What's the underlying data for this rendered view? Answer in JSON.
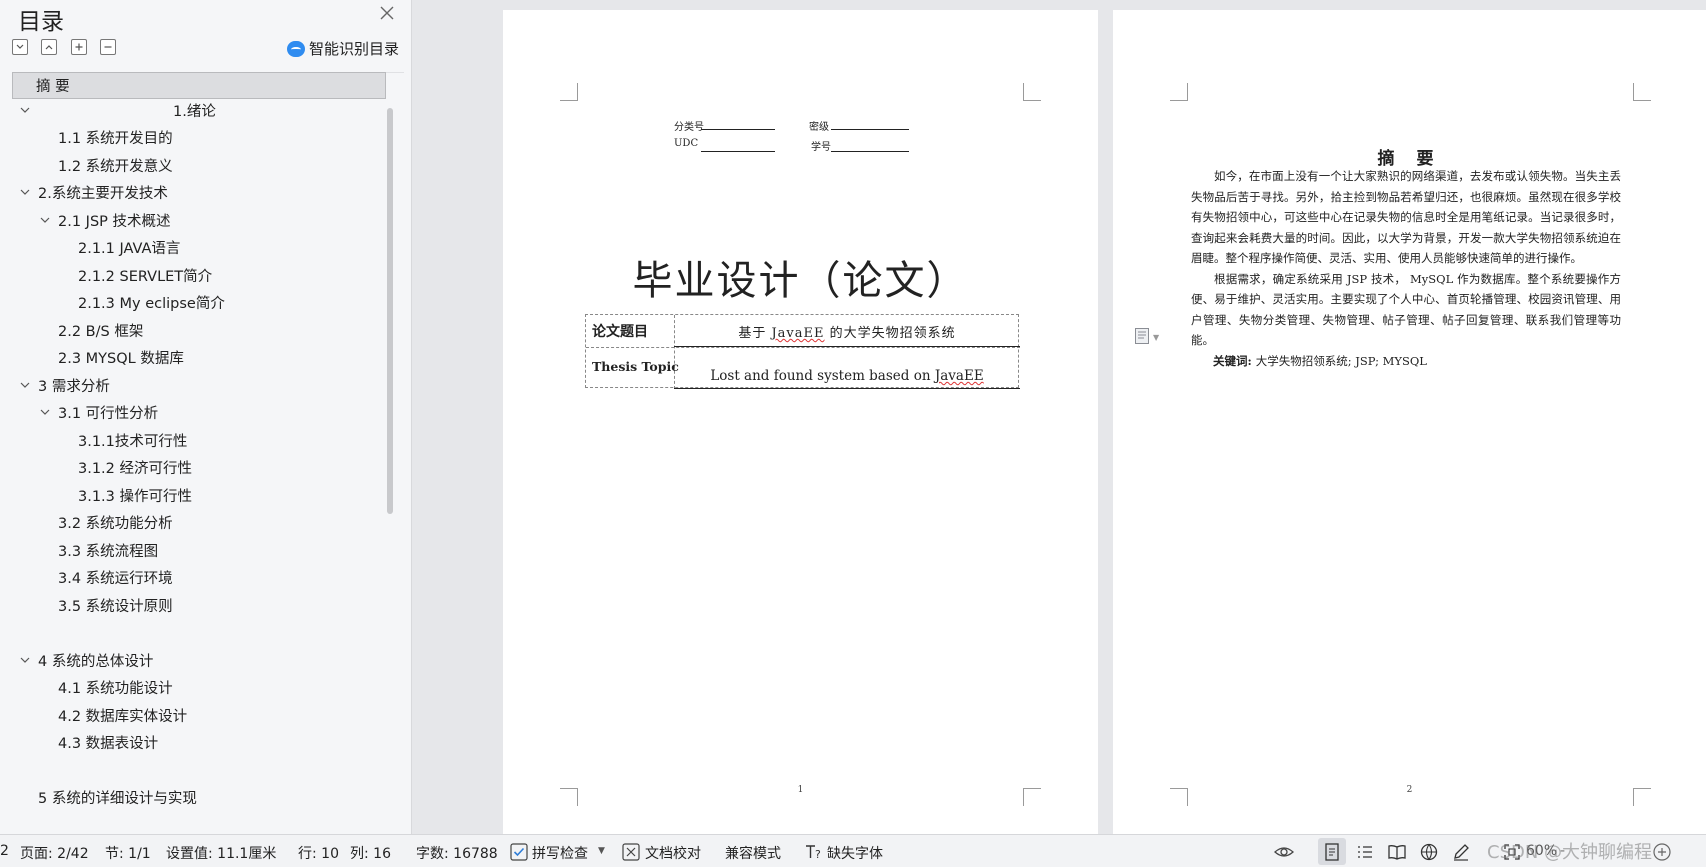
{
  "toc": {
    "title": "目录",
    "smart_toc_label": "智能识别目录",
    "items": [
      {
        "label": "摘  要"
      },
      {
        "label": "1.绪论"
      },
      {
        "label": "1.1 系统开发目的"
      },
      {
        "label": "1.2 系统开发意义"
      },
      {
        "label": "2.系统主要开发技术"
      },
      {
        "label": "2.1 JSP 技术概述"
      },
      {
        "label": "2.1.1 JAVA语言"
      },
      {
        "label": "2.1.2 SERVLET简介"
      },
      {
        "label": "2.1.3 My eclipse简介"
      },
      {
        "label": "2.2 B/S 框架"
      },
      {
        "label": "2.3 MYSQL 数据库"
      },
      {
        "label": "3  需求分析"
      },
      {
        "label": "3.1  可行性分析"
      },
      {
        "label": "3.1.1技术可行性"
      },
      {
        "label": "3.1.2  经济可行性"
      },
      {
        "label": "3.1.3  操作可行性"
      },
      {
        "label": "3.2  系统功能分析"
      },
      {
        "label": "3.3  系统流程图"
      },
      {
        "label": "3.4  系统运行环境"
      },
      {
        "label": "3.5  系统设计原则"
      },
      {
        "label": "4  系统的总体设计"
      },
      {
        "label": "4.1 系统功能设计"
      },
      {
        "label": "4.2 数据库实体设计"
      },
      {
        "label": "4.3 数据表设计"
      },
      {
        "label": "5 系统的详细设计与实现"
      }
    ]
  },
  "page1": {
    "class_no_label": "分类号",
    "secret_label": "密级",
    "udc_label": "UDC",
    "student_no_label": "学号",
    "title": "毕业设计（论文）",
    "topic_label_cn": "论文题目",
    "topic_cn": "基于 JavaEE 的大学失物招领系统",
    "topic_label_en": "Thesis Topic",
    "topic_en": "Lost and found system based on JavaEE",
    "page_number": "1"
  },
  "page2": {
    "heading": "摘 要",
    "para1": "如今，在市面上没有一个让大家熟识的网络渠道，去发布或认领失物。当失主丢失物品后苦于寻找。另外，拾主捡到物品若希望归还，也很麻烦。虽然现在很多学校有失物招领中心，可这些中心在记录失物的信息时全是用笔纸记录。当记录很多时，查询起来会耗费大量的时间。因此，以大学为背景，开发一款大学失物招领系统迫在眉睫。整个程序操作简便、灵活、实用、使用人员能够快速简单的进行操作。",
    "para2": "根据需求，确定系统采用 JSP 技术， MySQL 作为数据库。整个系统要操作方便、易于维护、灵活实用。主要实现了个人中心、首页轮播管理、校园资讯管理、用户管理、失物分类管理、失物管理、帖子管理、帖子回复管理、联系我们管理等功能。",
    "keywords_label": "关键词:",
    "keywords": "大学失物招领系统; JSP; MYSQL",
    "page_number": "2"
  },
  "statusbar": {
    "left_fragment": "2",
    "page": "页面: 2/42",
    "section": "节: 1/1",
    "position": "设置值: 11.1厘米",
    "row": "行: 10",
    "col": "列: 16",
    "wordcount": "字数: 16788",
    "spellcheck": "拼写检查",
    "doc_check": "文档校对",
    "compat": "兼容模式",
    "missing_font": "缺失字体",
    "zoom": "60%"
  },
  "watermark": "CSDN @大钟聊编程"
}
